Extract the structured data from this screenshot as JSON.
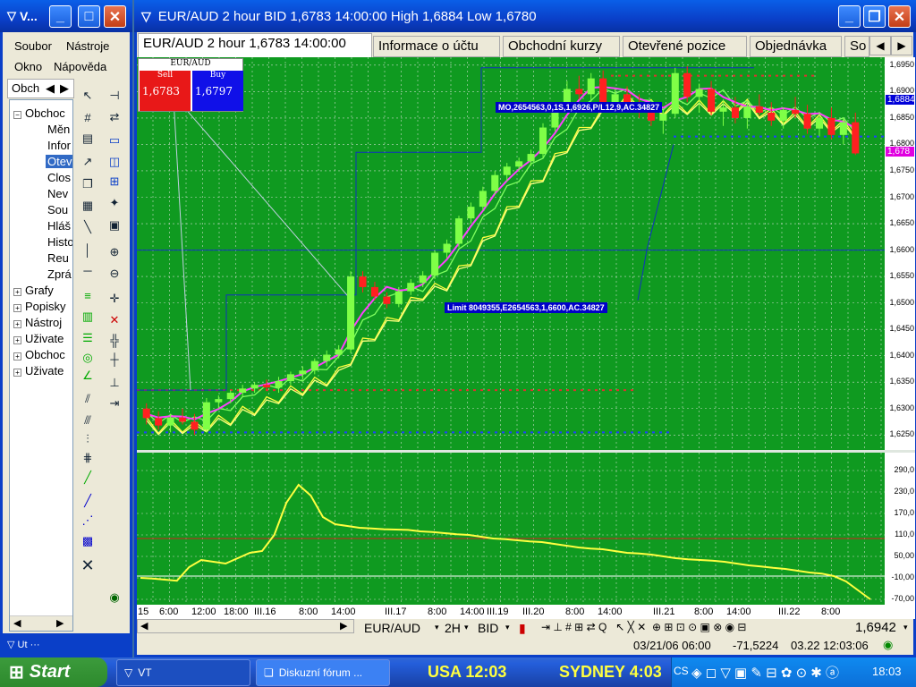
{
  "vt_window": {
    "title": "V...",
    "menu": [
      "Soubor",
      "Nástroje",
      "Okno",
      "Nápověda"
    ],
    "tab_label": "Obch"
  },
  "tree": {
    "root": "Obchoc",
    "children": [
      "Měn",
      "Infor",
      "Otev",
      "Clos",
      "Nev",
      "Sou",
      "Hláš",
      "Histo",
      "Reu",
      "Zprá"
    ],
    "top_nodes": [
      "Grafy",
      "Popisky",
      "Nástroj",
      "Uživate",
      "Obchoc",
      "Uživate"
    ]
  },
  "chart_window": {
    "title": "EUR/AUD 2 hour BID 1,6783 14:00:00 High 1,6884 Low 1,6780",
    "tabs": [
      "EUR/AUD 2 hour 1,6783 14:00:00",
      "Informace o účtu",
      "Obchodní kurzy",
      "Otevřené pozice",
      "Objednávka",
      "So"
    ],
    "quote_box": {
      "pair": "EUR/AUD",
      "sell_label": "Sell",
      "buy_label": "Buy",
      "sell": "1,6783",
      "buy": "1,6797"
    },
    "order_label_1": "MO,2654563,0,1S,1,6926,P/L12,9,AC.34827",
    "order_label_2": "Limit 8049355,E2654563,1,6600,AC.34827",
    "price_marker_1": "1,6884",
    "price_marker_2": "1,678",
    "toolbar": {
      "pair": "EUR/AUD",
      "timeframe": "2H",
      "side": "BID",
      "last": "1,6942"
    },
    "status": {
      "datetime": "03/21/06 06:00",
      "value": "-71,5224",
      "time": "03.22 12:03:06"
    }
  },
  "chart_data": [
    {
      "type": "candlestick",
      "y_ticks": [
        "1,6950",
        "1,6900",
        "1,6850",
        "1,6800",
        "1,6750",
        "1,6700",
        "1,6650",
        "1,6600",
        "1,6550",
        "1,6500",
        "1,6450",
        "1,6400",
        "1,6350",
        "1,6300",
        "1,6250"
      ],
      "ylim": [
        1.622,
        1.6965
      ],
      "x_ticks": [
        "15",
        "6:00",
        "12:00",
        "18:00",
        "III.16",
        "8:00",
        "14:00",
        "III.17",
        "8:00",
        "14:00",
        "III.19",
        "III.20",
        "8:00",
        "14:00",
        "III.21",
        "8:00",
        "14:00",
        "III.22",
        "8:00"
      ],
      "candles": [
        [
          1.63,
          1.631,
          1.627,
          1.6282
        ],
        [
          1.6282,
          1.6295,
          1.626,
          1.6268
        ],
        [
          1.6268,
          1.629,
          1.6255,
          1.6283
        ],
        [
          1.6283,
          1.63,
          1.627,
          1.6275
        ],
        [
          1.6275,
          1.629,
          1.625,
          1.626
        ],
        [
          1.626,
          1.632,
          1.6255,
          1.6312
        ],
        [
          1.6312,
          1.6325,
          1.63,
          1.6318
        ],
        [
          1.6318,
          1.6335,
          1.631,
          1.633
        ],
        [
          1.633,
          1.6345,
          1.6322,
          1.6338
        ],
        [
          1.6338,
          1.635,
          1.633,
          1.6345
        ],
        [
          1.6345,
          1.6355,
          1.6335,
          1.634
        ],
        [
          1.634,
          1.636,
          1.633,
          1.6352
        ],
        [
          1.6352,
          1.637,
          1.6345,
          1.6365
        ],
        [
          1.6365,
          1.638,
          1.6355,
          1.6372
        ],
        [
          1.6372,
          1.6395,
          1.6365,
          1.639
        ],
        [
          1.639,
          1.641,
          1.638,
          1.6402
        ],
        [
          1.6402,
          1.642,
          1.6395,
          1.6412
        ],
        [
          1.6412,
          1.656,
          1.6405,
          1.655
        ],
        [
          1.655,
          1.656,
          1.652,
          1.653
        ],
        [
          1.653,
          1.654,
          1.6505,
          1.6512
        ],
        [
          1.6512,
          1.652,
          1.649,
          1.6498
        ],
        [
          1.6498,
          1.653,
          1.6492,
          1.6522
        ],
        [
          1.6522,
          1.6545,
          1.6515,
          1.6538
        ],
        [
          1.6538,
          1.656,
          1.653,
          1.6552
        ],
        [
          1.6552,
          1.66,
          1.6545,
          1.6595
        ],
        [
          1.6595,
          1.662,
          1.6585,
          1.6612
        ],
        [
          1.6612,
          1.6665,
          1.6605,
          1.666
        ],
        [
          1.666,
          1.669,
          1.665,
          1.6682
        ],
        [
          1.6682,
          1.672,
          1.6675,
          1.6712
        ],
        [
          1.6712,
          1.675,
          1.6705,
          1.6742
        ],
        [
          1.6742,
          1.6765,
          1.673,
          1.6758
        ],
        [
          1.6758,
          1.6775,
          1.6748,
          1.6768
        ],
        [
          1.6768,
          1.679,
          1.676,
          1.6782
        ],
        [
          1.6782,
          1.684,
          1.6775,
          1.6832
        ],
        [
          1.6832,
          1.688,
          1.6825,
          1.6872
        ],
        [
          1.6872,
          1.692,
          1.686,
          1.6905
        ],
        [
          1.6905,
          1.693,
          1.6885,
          1.6895
        ],
        [
          1.6895,
          1.6935,
          1.688,
          1.6925
        ],
        [
          1.6925,
          1.694,
          1.687,
          1.6878
        ],
        [
          1.6878,
          1.6905,
          1.686,
          1.6895
        ],
        [
          1.6895,
          1.691,
          1.687,
          1.688
        ],
        [
          1.688,
          1.6895,
          1.685,
          1.6862
        ],
        [
          1.6862,
          1.688,
          1.6835,
          1.6845
        ],
        [
          1.6845,
          1.6865,
          1.682,
          1.6858
        ],
        [
          1.6858,
          1.6945,
          1.685,
          1.6935
        ],
        [
          1.6935,
          1.6948,
          1.688,
          1.689
        ],
        [
          1.689,
          1.6915,
          1.686,
          1.6905
        ],
        [
          1.6905,
          1.692,
          1.6855,
          1.6862
        ],
        [
          1.6862,
          1.6885,
          1.6835,
          1.687
        ],
        [
          1.687,
          1.689,
          1.684,
          1.685
        ],
        [
          1.685,
          1.688,
          1.683,
          1.6872
        ],
        [
          1.6872,
          1.6895,
          1.6855,
          1.686
        ],
        [
          1.686,
          1.688,
          1.6835,
          1.6845
        ],
        [
          1.6845,
          1.687,
          1.683,
          1.6865
        ],
        [
          1.6865,
          1.689,
          1.685,
          1.6858
        ],
        [
          1.6858,
          1.6875,
          1.682,
          1.683
        ],
        [
          1.683,
          1.686,
          1.6815,
          1.685
        ],
        [
          1.685,
          1.687,
          1.681,
          1.6818
        ],
        [
          1.6818,
          1.685,
          1.68,
          1.6842
        ],
        [
          1.6842,
          1.686,
          1.678,
          1.6783
        ]
      ]
    },
    {
      "type": "line",
      "y_ticks": [
        "290,0",
        "230,0",
        "170,0",
        "110,0",
        "50,00",
        "-10,00",
        "-70,00"
      ],
      "ylim": [
        -85,
        340
      ],
      "values": [
        -10,
        -12,
        -15,
        -18,
        20,
        40,
        35,
        30,
        45,
        60,
        65,
        110,
        200,
        250,
        220,
        160,
        140,
        135,
        130,
        128,
        126,
        125,
        124,
        120,
        118,
        115,
        112,
        110,
        105,
        100,
        98,
        95,
        92,
        90,
        85,
        80,
        75,
        72,
        70,
        65,
        60,
        58,
        55,
        50,
        45,
        42,
        40,
        38,
        35,
        30,
        25,
        22,
        18,
        15,
        10,
        5,
        2,
        -5,
        -20,
        -45,
        -70
      ]
    }
  ],
  "taskbar": {
    "start": "Start",
    "items": [
      "VT",
      "Diskuzní fórum ..."
    ],
    "ticker_1": "USA 12:03",
    "ticker_2": "SYDNEY 4:03",
    "tray_text": "CS",
    "clock": "18:03"
  },
  "colors": {
    "chart_bg": "#0f9a20",
    "grid": "#c9dcc9",
    "bull": "#7fff47",
    "bear": "#ff2020",
    "xp_blue": "#0a3fc8"
  }
}
